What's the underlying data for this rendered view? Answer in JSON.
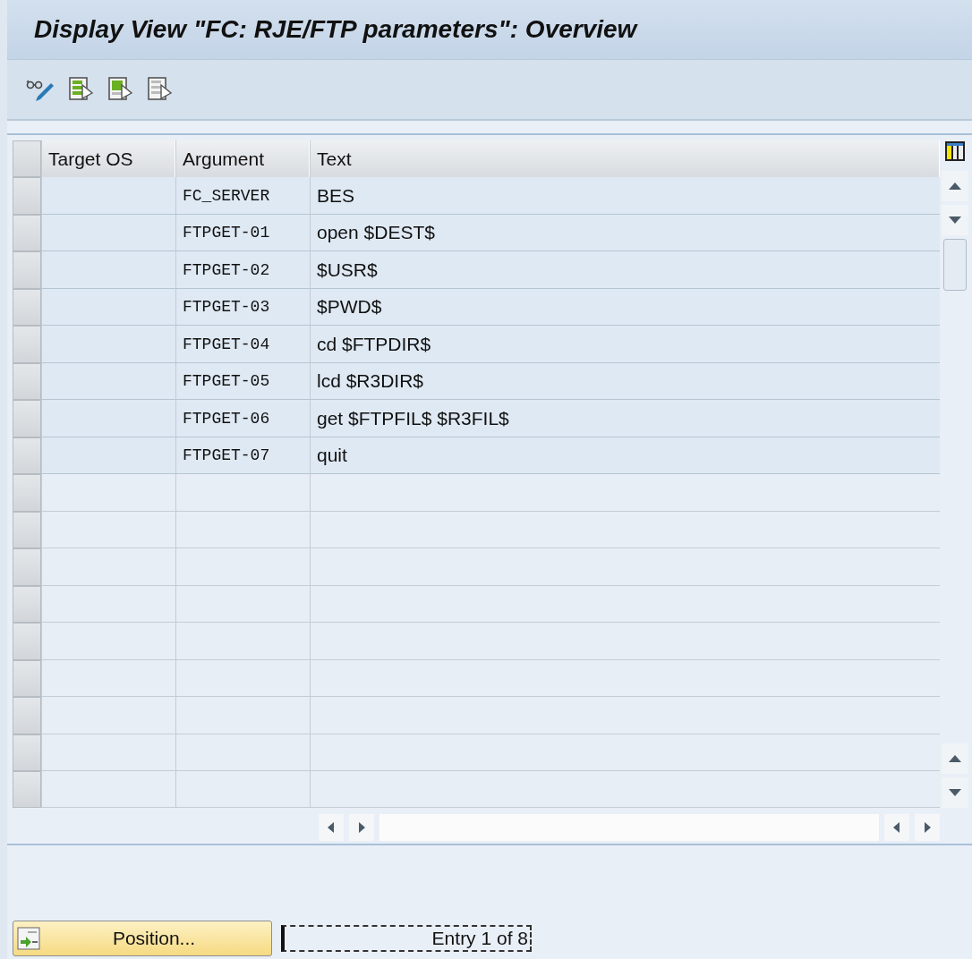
{
  "window": {
    "title": "Display View \"FC: RJE/FTP parameters\": Overview"
  },
  "toolbar": {
    "buttons": [
      {
        "kind": "display-change"
      },
      {
        "kind": "rows-full"
      },
      {
        "kind": "rows-block"
      },
      {
        "kind": "rows-empty"
      }
    ]
  },
  "table": {
    "columns": [
      "Target OS",
      "Argument",
      "Text"
    ],
    "rows": [
      {
        "target_os": "",
        "argument": "FC_SERVER",
        "text": "BES"
      },
      {
        "target_os": "",
        "argument": "FTPGET-01",
        "text": "open $DEST$"
      },
      {
        "target_os": "",
        "argument": "FTPGET-02",
        "text": "$USR$"
      },
      {
        "target_os": "",
        "argument": "FTPGET-03",
        "text": "$PWD$"
      },
      {
        "target_os": "",
        "argument": "FTPGET-04",
        "text": "cd $FTPDIR$"
      },
      {
        "target_os": "",
        "argument": "FTPGET-05",
        "text": "lcd $R3DIR$"
      },
      {
        "target_os": "",
        "argument": "FTPGET-06",
        "text": "get $FTPFIL$ $R3FIL$"
      },
      {
        "target_os": "",
        "argument": "FTPGET-07",
        "text": "quit"
      }
    ]
  },
  "footer": {
    "position_button": "Position...",
    "entry_info": "Entry 1 of 8"
  }
}
